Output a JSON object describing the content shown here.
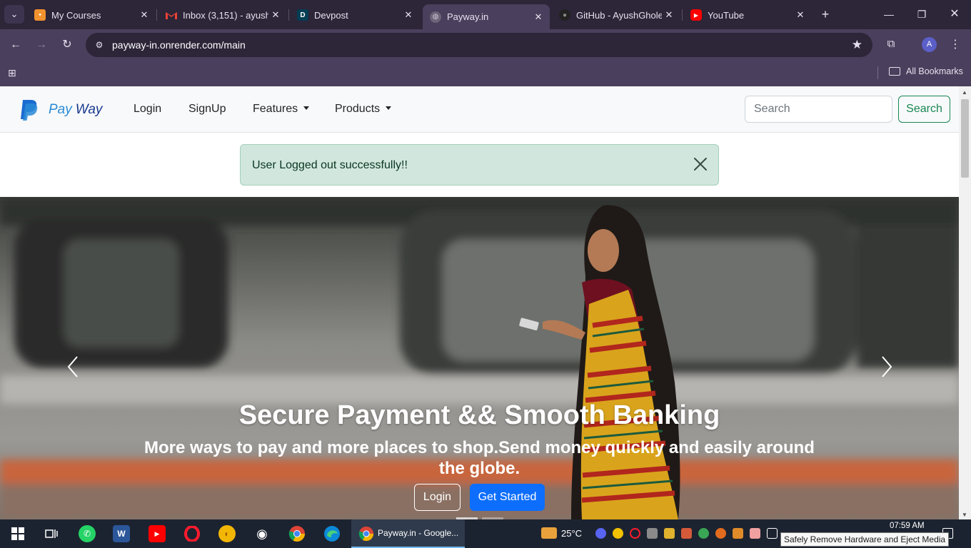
{
  "browser": {
    "tabs": [
      {
        "title": "My Courses",
        "favicon": "coding-ninjas-icon",
        "active": false
      },
      {
        "title": "Inbox (3,151) - ayush",
        "favicon": "gmail-icon",
        "active": false
      },
      {
        "title": "Devpost",
        "favicon": "devpost-icon",
        "active": false
      },
      {
        "title": "Payway.in",
        "favicon": "globe-icon",
        "active": true
      },
      {
        "title": "GitHub - AyushGhole",
        "favicon": "github-icon",
        "active": false
      },
      {
        "title": "YouTube",
        "favicon": "youtube-icon",
        "active": false
      }
    ],
    "url": "payway-in.onrender.com/main",
    "profile_initial": "A",
    "all_bookmarks": "All Bookmarks"
  },
  "navbar": {
    "brand_pay": "Pay",
    "brand_way": "Way",
    "links": {
      "login": "Login",
      "signup": "SignUp",
      "features": "Features",
      "products": "Products"
    },
    "search_placeholder": "Search",
    "search_button": "Search"
  },
  "alert": {
    "message": "User Logged out successfully!!"
  },
  "hero": {
    "title": "Secure Payment && Smooth Banking",
    "subtitle": "More ways to pay and more places to shop.Send money quickly and easily around the globe.",
    "login_button": "Login",
    "get_started_button": "Get Started"
  },
  "taskbar": {
    "active_window": "Payway.in - Google...",
    "temperature": "25°C",
    "time": "07:59 AM",
    "tooltip": "Safely Remove Hardware and Eject Media"
  },
  "colors": {
    "chrome_dark": "#2d2538",
    "chrome_toolbar": "#4a3f5c",
    "brand_light": "#2a8ad6",
    "brand_dark": "#1a3a8f",
    "success": "#198754",
    "alert_bg": "#d1e7dd",
    "primary": "#0d6efd",
    "taskbar": "#1c2330"
  }
}
